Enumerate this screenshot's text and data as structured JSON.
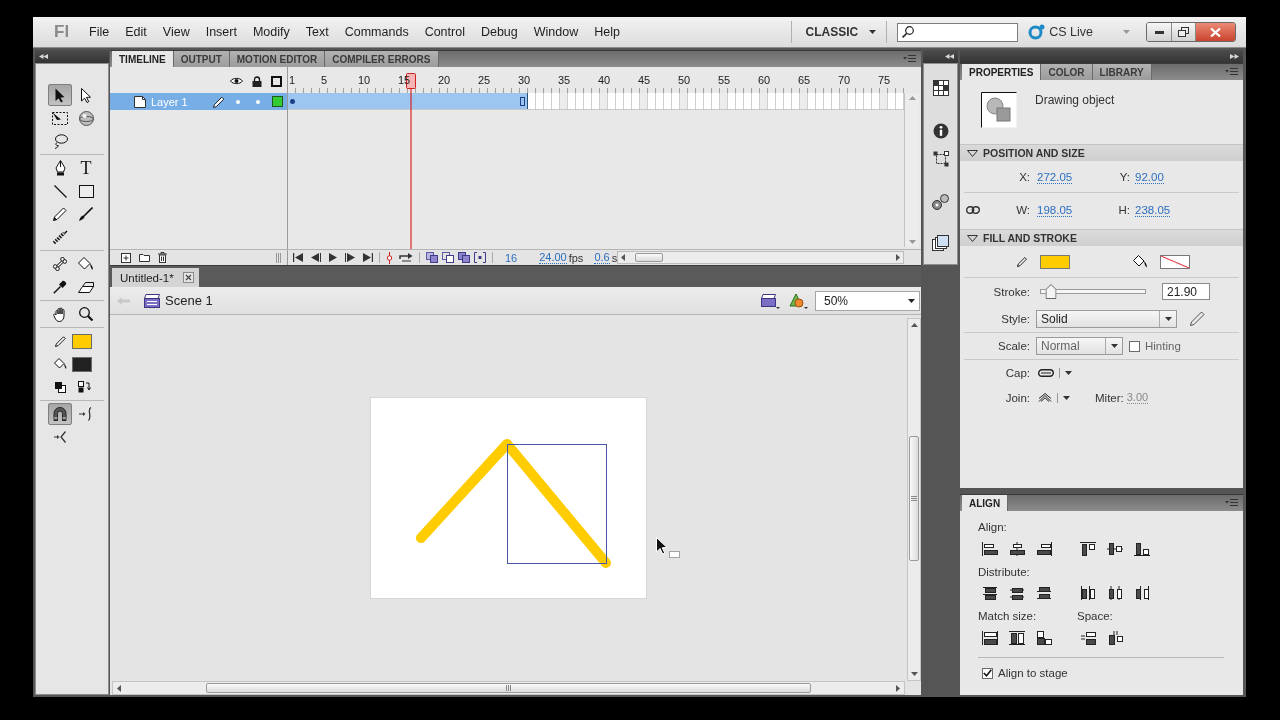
{
  "app": {
    "logo": "Fl"
  },
  "menu": [
    "File",
    "Edit",
    "View",
    "Insert",
    "Modify",
    "Text",
    "Commands",
    "Control",
    "Debug",
    "Window",
    "Help"
  ],
  "workspace": {
    "label": "CLASSIC"
  },
  "cs_live": {
    "label": "CS Live"
  },
  "tools": {
    "groups": [
      [
        {
          "selected": true
        },
        {
          "selected": false
        },
        {
          "selected": false
        },
        {
          "selected": false
        },
        {
          "selected": false
        }
      ],
      [
        {
          "selected": false
        },
        {
          "selected": false,
          "glyph": "T"
        },
        {
          "selected": false
        },
        {
          "selected": false
        },
        {
          "selected": false
        },
        {
          "selected": false
        },
        {
          "selected": false
        }
      ],
      [
        {
          "selected": false
        },
        {
          "selected": false
        },
        {
          "selected": false
        },
        {
          "selected": false
        }
      ],
      [
        {
          "selected": false
        },
        {
          "selected": false
        }
      ]
    ],
    "stroke": {
      "color": "#ffcc00"
    },
    "fill": {
      "color": "#222222"
    },
    "options": [
      {
        "selected": true
      },
      {
        "selected": false
      },
      {
        "selected": false
      }
    ]
  },
  "timeline": {
    "tabs": [
      {
        "label": "TIMELINE",
        "selected": true
      },
      {
        "label": "OUTPUT",
        "selected": false
      },
      {
        "label": "MOTION EDITOR",
        "selected": false
      },
      {
        "label": "COMPILER ERRORS",
        "selected": false
      }
    ],
    "frame_numbers": [
      "1",
      "5",
      "10",
      "15",
      "20",
      "25",
      "30",
      "35",
      "40",
      "45",
      "50",
      "55",
      "60",
      "65",
      "70",
      "75"
    ],
    "playhead": {
      "level": 0.2
    },
    "layers": [
      {
        "name": "Layer 1",
        "selected": true,
        "color": "#33cc33",
        "frames": {
          "level": 0.39
        }
      }
    ],
    "current_frame": "16",
    "frame_rate": {
      "value": "24.00",
      "unit": "fps"
    },
    "elapsed": {
      "value": "0.6",
      "unit": "s"
    }
  },
  "documents": [
    {
      "title": "Untitled-1*",
      "selected": true
    }
  ],
  "edit_bar": {
    "scene": "Scene 1",
    "zoom": "50%"
  },
  "properties": {
    "tabs": [
      {
        "label": "PROPERTIES",
        "selected": true
      },
      {
        "label": "COLOR",
        "selected": false
      },
      {
        "label": "LIBRARY",
        "selected": false
      }
    ],
    "object_type": "Drawing object",
    "sections": [
      {
        "title": "POSITION AND SIZE",
        "expanded": true
      },
      {
        "title": "FILL AND STROKE",
        "expanded": true
      }
    ],
    "position": [
      {
        "label": "X:",
        "value": "272.05"
      },
      {
        "label": "Y:",
        "value": "92.00"
      },
      {
        "label": "W:",
        "value": "198.05"
      },
      {
        "label": "H:",
        "value": "238.05"
      }
    ],
    "stroke_swatch": {
      "kind": "solid",
      "color": "#ffcc00"
    },
    "fill_swatch": {
      "kind": "none"
    },
    "stroke": {
      "label": "Stroke:",
      "level": 0.1,
      "value": "21.90"
    },
    "style": {
      "label": "Style:",
      "value": "Solid"
    },
    "scale": {
      "label": "Scale:",
      "value": "Normal"
    },
    "hinting": {
      "label": "Hinting",
      "checked": false
    },
    "cap": {
      "label": "Cap:"
    },
    "join": {
      "label": "Join:"
    },
    "miter": {
      "label": "Miter:",
      "value": "3.00",
      "disabled": true
    }
  },
  "align": {
    "tab": "ALIGN",
    "align_label": "Align:",
    "distribute_label": "Distribute:",
    "match_label": "Match size:",
    "space_label": "Space:",
    "align_to_stage": {
      "label": "Align to stage",
      "checked": true
    }
  }
}
